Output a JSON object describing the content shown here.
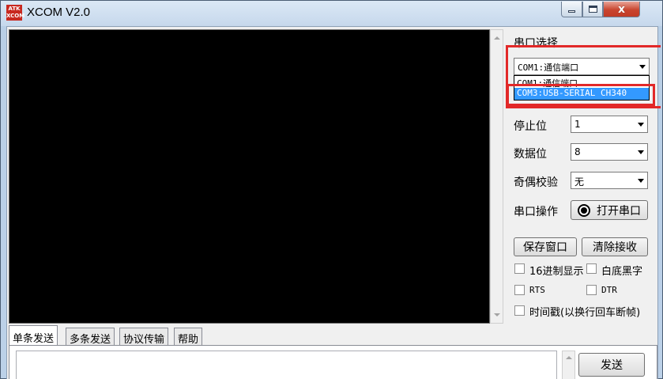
{
  "window": {
    "title": "XCOM V2.0",
    "icon_text_top": "ATK",
    "icon_text_bottom": "XCOM",
    "min_icon": "minimize-icon",
    "max_icon": "maximize-icon",
    "close_icon": "close-icon",
    "close_glyph": "x"
  },
  "serial": {
    "port_label": "串口选择",
    "port_selected": "COM1:通信端口",
    "port_options": [
      "COM1:通信端口",
      "COM3:USB-SERIAL CH340"
    ],
    "highlight_color": "#e22828",
    "stop_label": "停止位",
    "stop_value": "1",
    "data_label": "数据位",
    "data_value": "8",
    "parity_label": "奇偶校验",
    "parity_value": "无",
    "op_label": "串口操作",
    "open_button": "打开串口"
  },
  "actions": {
    "save_button": "保存窗口",
    "clear_button": "清除接收"
  },
  "options": {
    "hex_display": "16进制显示",
    "white_bg": "白底黑字",
    "rts": "RTS",
    "dtr": "DTR",
    "timestamp": "时间戳(以换行回车断帧)"
  },
  "tabs": [
    "单条发送",
    "多条发送",
    "协议传输",
    "帮助"
  ],
  "send": {
    "button": "发送"
  }
}
